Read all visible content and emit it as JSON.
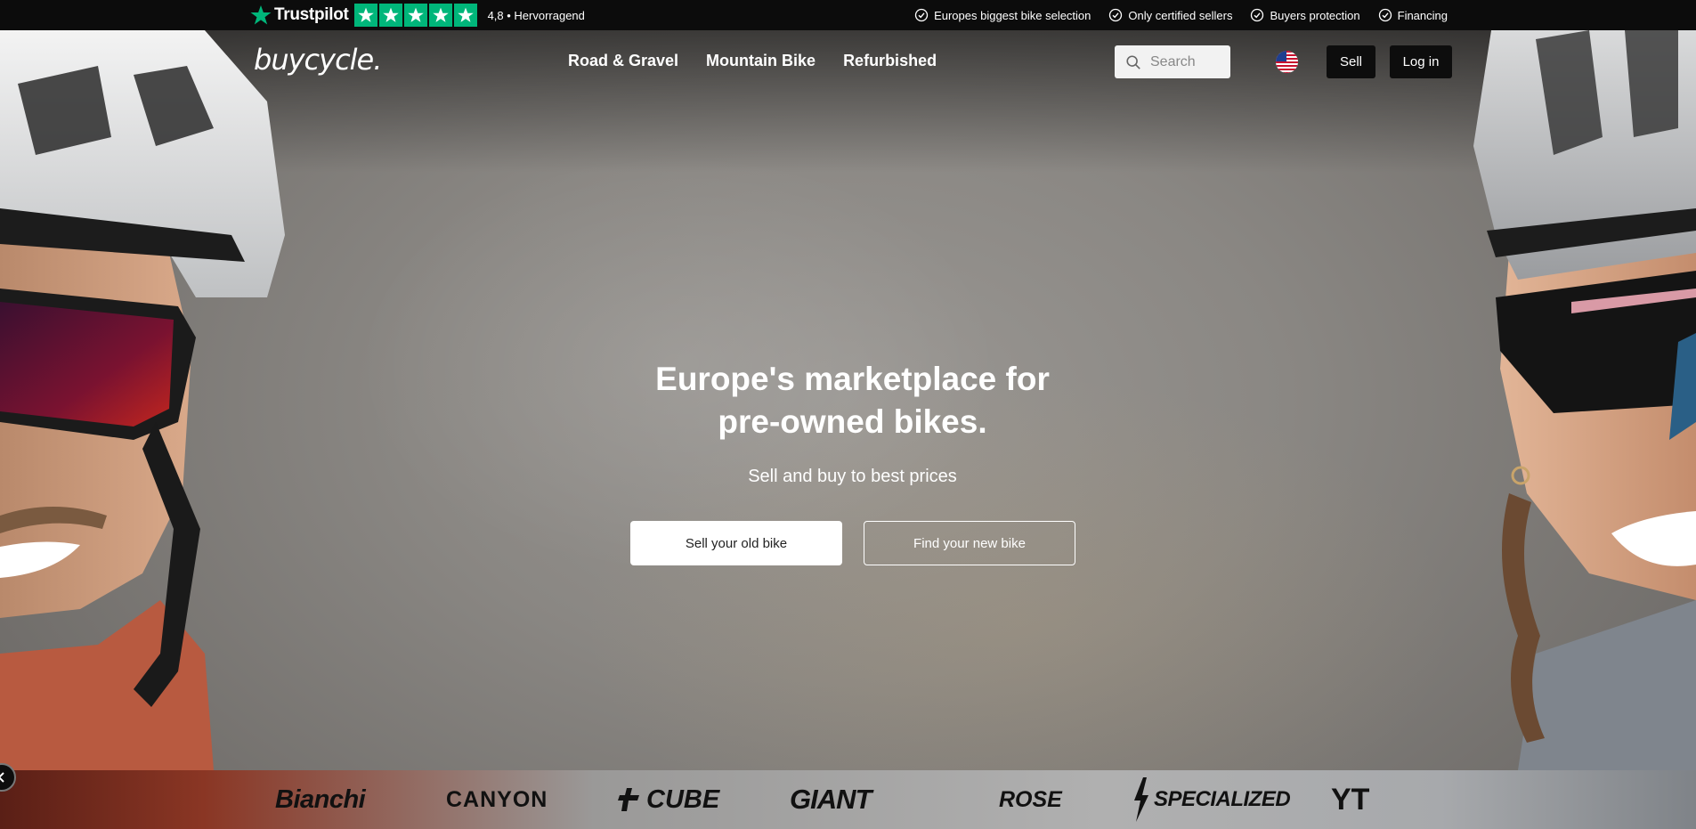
{
  "trustpilot": {
    "brand": "Trustpilot",
    "rating_text": "4,8 • Hervorragend",
    "stars": 5,
    "star_color": "#00b67a"
  },
  "usps": [
    {
      "icon": "check-circle-icon",
      "label": "Europes biggest bike selection"
    },
    {
      "icon": "check-circle-icon",
      "label": "Only certified sellers"
    },
    {
      "icon": "check-circle-icon",
      "label": "Buyers protection"
    },
    {
      "icon": "check-circle-icon",
      "label": "Financing"
    }
  ],
  "header": {
    "logo": "buycycle.",
    "menu": [
      "Road & Gravel",
      "Mountain Bike",
      "Refurbished"
    ],
    "search_placeholder": "Search",
    "language_flag": "us-flag-icon",
    "sell_label": "Sell",
    "login_label": "Log in"
  },
  "hero": {
    "title_line1": "Europe's marketplace for",
    "title_line2": "pre-owned bikes.",
    "subtitle": "Sell and buy to best prices",
    "primary_cta": "Sell your old bike",
    "secondary_cta": "Find your new bike"
  },
  "brands": [
    "Bianchi",
    "CANYON",
    "CUBE",
    "GIANT",
    "ROSE",
    "SPECIALIZED",
    "YT"
  ],
  "colors": {
    "topbar_bg": "#0c0c0c",
    "button_dark": "#0d0d0d",
    "trustpilot_green": "#00b67a"
  }
}
